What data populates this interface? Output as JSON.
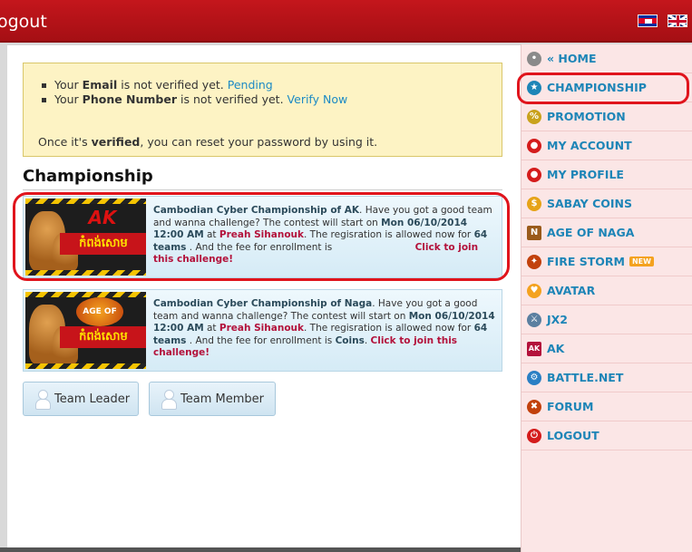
{
  "header": {
    "title": "ogout",
    "flags": [
      "cambodia-flag",
      "uk-flag"
    ]
  },
  "notice": {
    "email_prefix": "Your",
    "email_bold": "Email",
    "email_text": "is not verified yet.",
    "email_link": "Pending",
    "phone_prefix": "Your",
    "phone_bold": "Phone Number",
    "phone_text": "is not verified yet.",
    "phone_link": "Verify Now",
    "note_prefix": "Once it's",
    "note_bold": "verified",
    "note_suffix": ", you can reset your password by using it."
  },
  "section_title": "Championship",
  "championships": [
    {
      "banner": "កំពង់សោម",
      "logo": "AK",
      "name": "Cambodian Cyber Championship of AK",
      "t1": ". Have you got a good team and wanna challenge? The contest will start on",
      "date": "Mon 06/10/2014 12:00 AM",
      "t2": "at",
      "place": "Preah Sihanouk",
      "t3": ". The regisration is allowed now for",
      "teams": "64 teams",
      "t4": ". And the fee for enrollment is",
      "fee": "",
      "join": "Click to join this challenge!"
    },
    {
      "banner": "កំពង់សោម",
      "logo": "AGE OF NAGA",
      "name": "Cambodian Cyber Championship of Naga",
      "t1": ". Have you got a good team and wanna challenge? The contest will start on",
      "date": "Mon 06/10/2014 12:00 AM",
      "t2": "at",
      "place": "Preah Sihanouk",
      "t3": ". The regisration is allowed now for",
      "teams": "64 teams",
      "t4": ". And the fee for enrollment is",
      "fee": "Coins",
      "join": "Click to join this challenge!"
    }
  ],
  "buttons": {
    "team_leader": "Team Leader",
    "team_member": "Team Member"
  },
  "sidebar": {
    "items": [
      {
        "label": "« HOME",
        "icon": "home-icon",
        "color": "#8a8a8a"
      },
      {
        "label": "CHAMPIONSHIP",
        "icon": "championship-icon",
        "color": "#1d85b7"
      },
      {
        "label": "PROMOTION",
        "icon": "promotion-icon",
        "color": "#c9a21c"
      },
      {
        "label": "MY ACCOUNT",
        "icon": "account-icon",
        "color": "#d41c1c"
      },
      {
        "label": "MY PROFILE",
        "icon": "profile-icon",
        "color": "#d41c1c"
      },
      {
        "label": "SABAY COINS",
        "icon": "coins-icon",
        "color": "#e6a317"
      },
      {
        "label": "AGE OF NAGA",
        "icon": "naga-icon",
        "color": "#9a5a1a"
      },
      {
        "label": "FIRE STORM",
        "icon": "firestorm-icon",
        "color": "#c2410c",
        "badge": "NEW"
      },
      {
        "label": "AVATAR",
        "icon": "avatar-icon",
        "color": "#f4a21f"
      },
      {
        "label": "JX2",
        "icon": "jx2-icon",
        "color": "#5a7fa0"
      },
      {
        "label": "AK",
        "icon": "ak-icon",
        "color": "#b3123b"
      },
      {
        "label": "BATTLE.NET",
        "icon": "battlenet-icon",
        "color": "#2a7fc4"
      },
      {
        "label": "FORUM",
        "icon": "forum-icon",
        "color": "#c2410c"
      },
      {
        "label": "LOGOUT",
        "icon": "logout-icon",
        "color": "#d41c1c"
      }
    ]
  }
}
